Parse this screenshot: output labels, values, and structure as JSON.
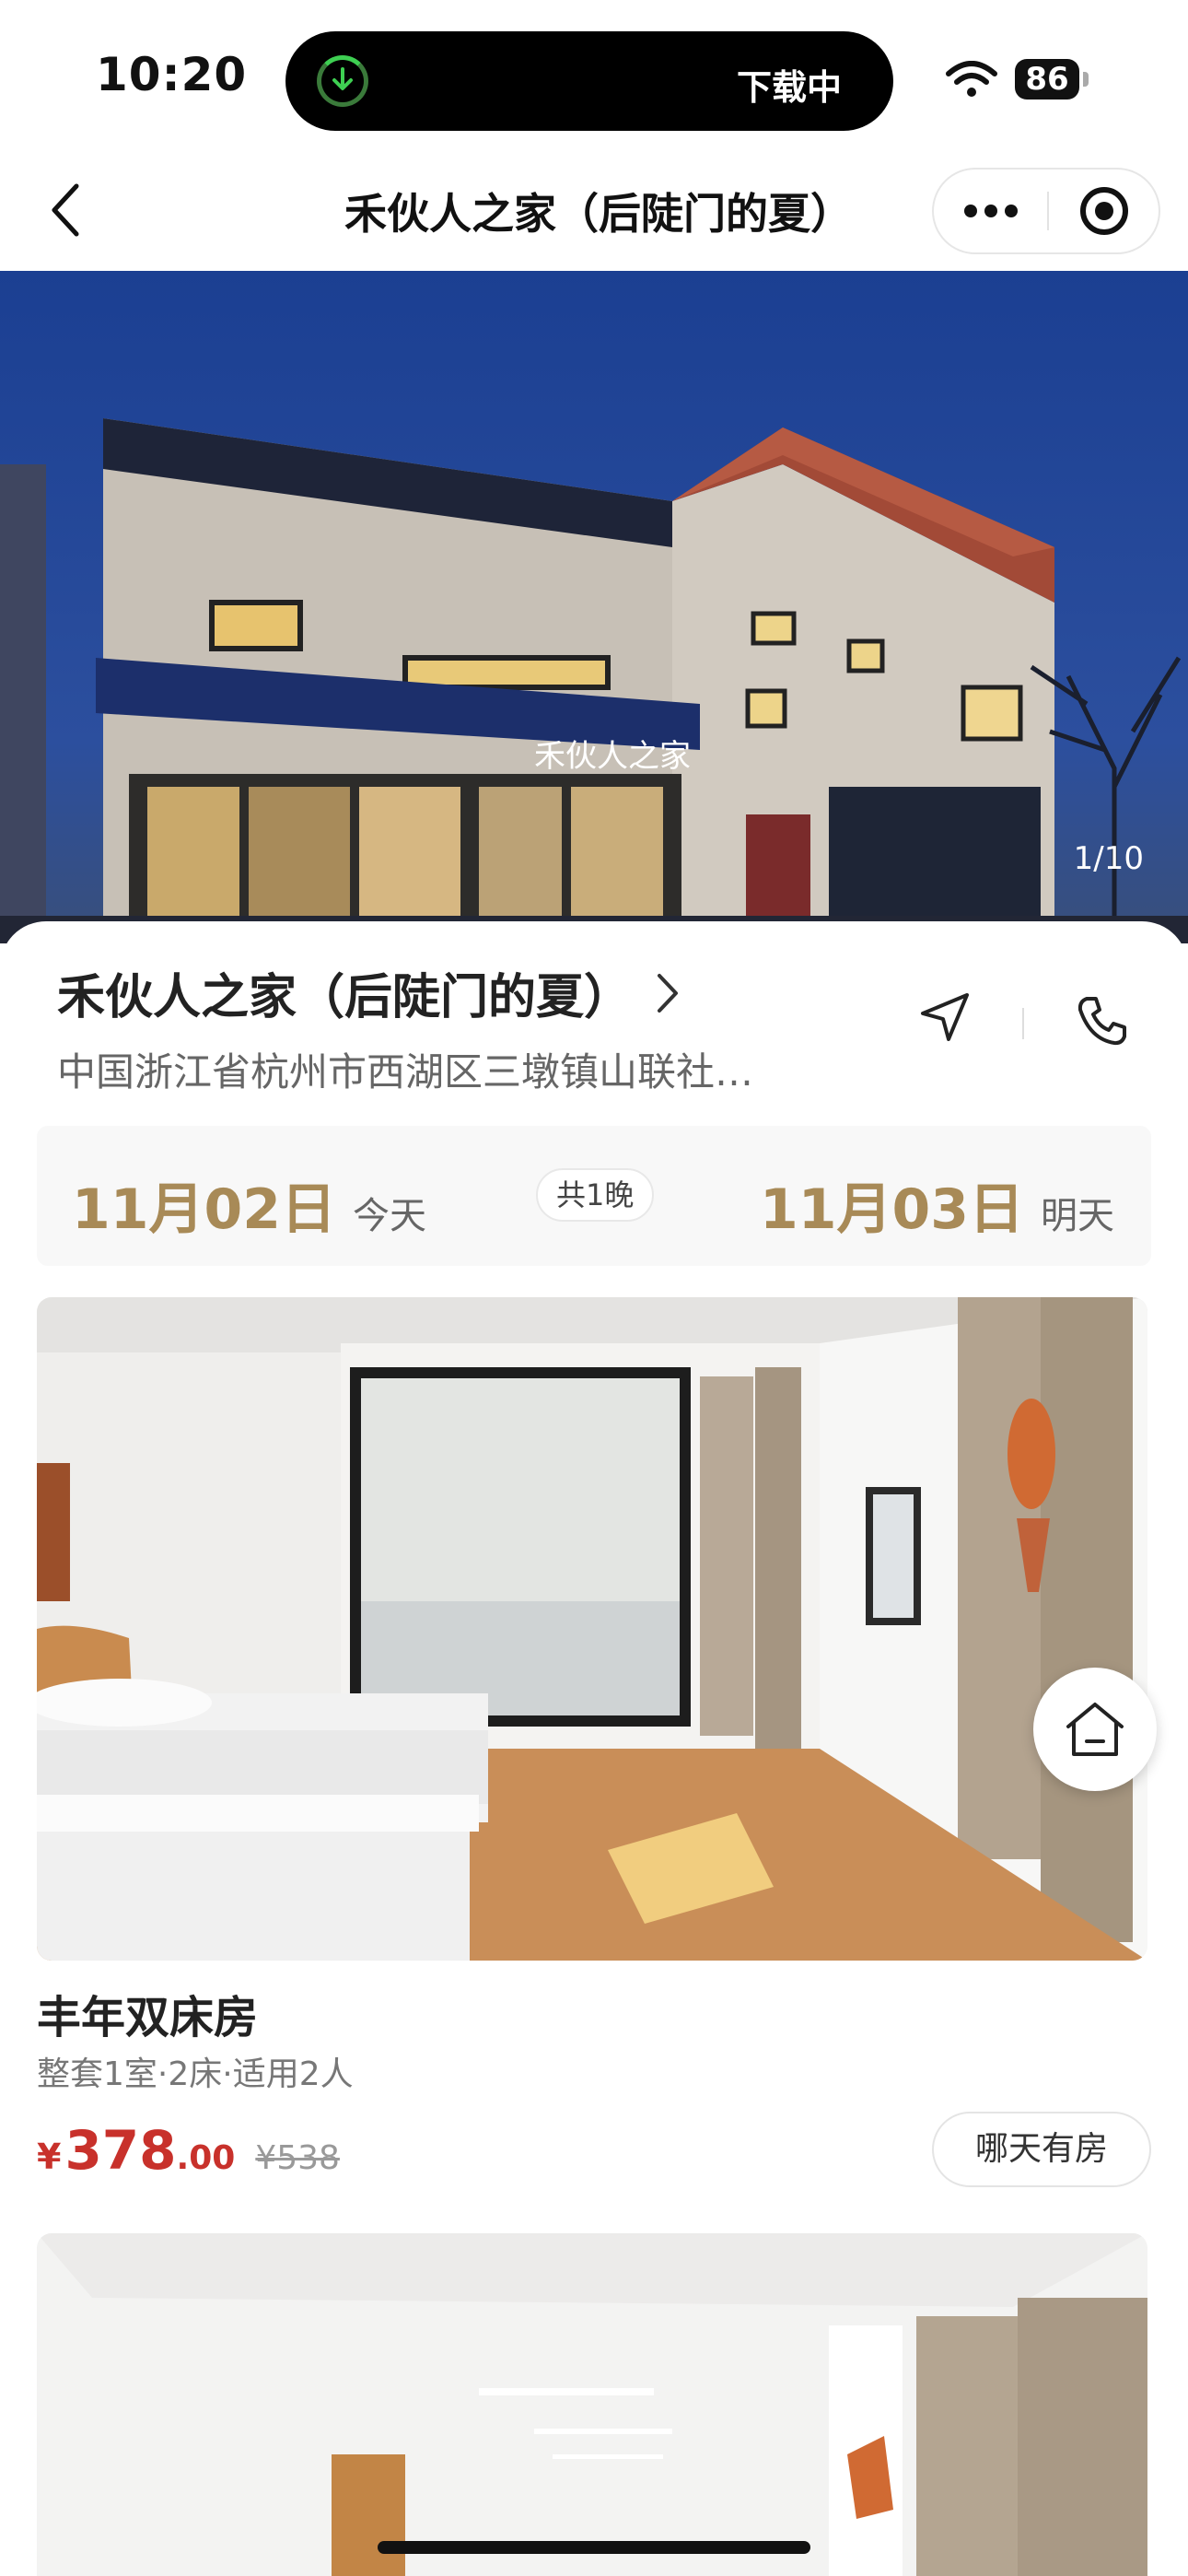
{
  "status_bar": {
    "time": "10:20",
    "download_label": "下载中",
    "battery": "86"
  },
  "nav": {
    "title": "禾伙人之家（后陡门的夏）"
  },
  "hero": {
    "photo_counter": "1/10",
    "sign_text": "禾伙人之家"
  },
  "hotel": {
    "name": "禾伙人之家（后陡门的夏）",
    "address": "中国浙江省杭州市西湖区三墩镇山联社…"
  },
  "dates": {
    "checkin_date": "11月02日",
    "checkin_label": "今天",
    "nights": "共1晚",
    "checkout_date": "11月03日",
    "checkout_label": "明天"
  },
  "rooms": [
    {
      "name": "丰年双床房",
      "description": "整套1室·2床·适用2人",
      "currency": "¥",
      "price_int": "378",
      "price_dec": ".00",
      "original_price": "¥538",
      "availability_button": "哪天有房"
    }
  ],
  "colors": {
    "date_accent": "#a88a57",
    "price_red": "#c8312b",
    "download_green": "#3ecf52"
  },
  "icons": {
    "back": "chevron-left-icon",
    "more": "more-dots-icon",
    "close": "target-circle-icon",
    "hotel_arrow": "chevron-right-icon",
    "navigation": "navigation-arrow-icon",
    "phone": "phone-icon",
    "home": "home-icon"
  }
}
